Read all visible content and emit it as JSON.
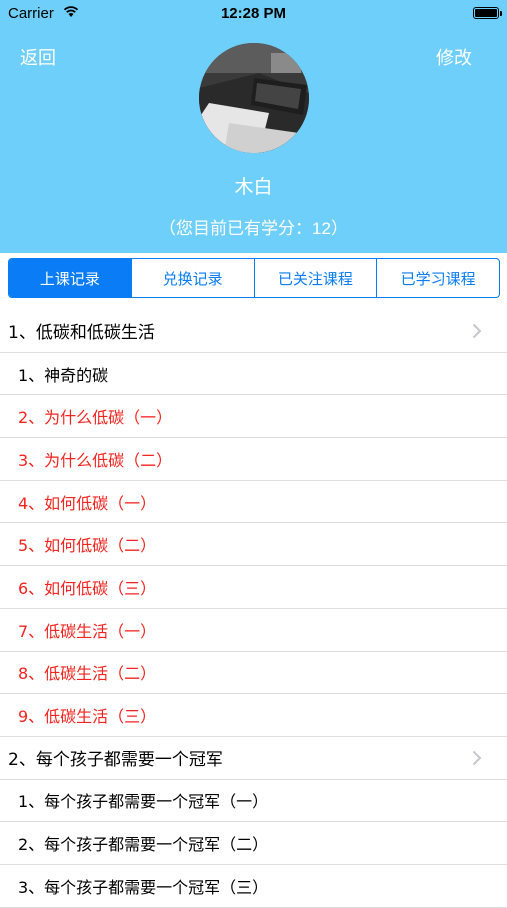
{
  "status_bar": {
    "carrier": "Carrier",
    "time": "12:28 PM",
    "battery_level": 1.0
  },
  "nav": {
    "back_label": "返回",
    "edit_label": "修改"
  },
  "profile": {
    "name": "木白",
    "credits_prefix": "（您目前已有学分：",
    "credits_value": "12",
    "credits_suffix": "）"
  },
  "tabs": [
    {
      "label": "上课记录",
      "active": true
    },
    {
      "label": "兑换记录",
      "active": false
    },
    {
      "label": "已关注课程",
      "active": false
    },
    {
      "label": "已学习课程",
      "active": false
    }
  ],
  "list": {
    "rows": [
      {
        "label": "1、低碳和低碳生活"
      },
      {
        "label": "1、神奇的碳"
      },
      {
        "label": "2、为什么低碳（一）"
      },
      {
        "label": "3、为什么低碳（二）"
      },
      {
        "label": "4、如何低碳（一）"
      },
      {
        "label": "5、如何低碳（二）"
      },
      {
        "label": "6、如何低碳（三）"
      },
      {
        "label": "7、低碳生活（一）"
      },
      {
        "label": "8、低碳生活（二）"
      },
      {
        "label": "9、低碳生活（三）"
      },
      {
        "label": "2、每个孩子都需要一个冠军"
      },
      {
        "label": "1、每个孩子都需要一个冠军（一）"
      },
      {
        "label": "2、每个孩子都需要一个冠军（二）"
      },
      {
        "label": "3、每个孩子都需要一个冠军（三）"
      }
    ]
  },
  "colors": {
    "header_bg": "#6fcffb",
    "accent_blue": "#0a7cf6",
    "highlight_red": "#f5231f"
  },
  "icons": {
    "wifi": "wifi-icon",
    "battery": "battery-icon",
    "disclosure": "chevron-right-icon"
  }
}
